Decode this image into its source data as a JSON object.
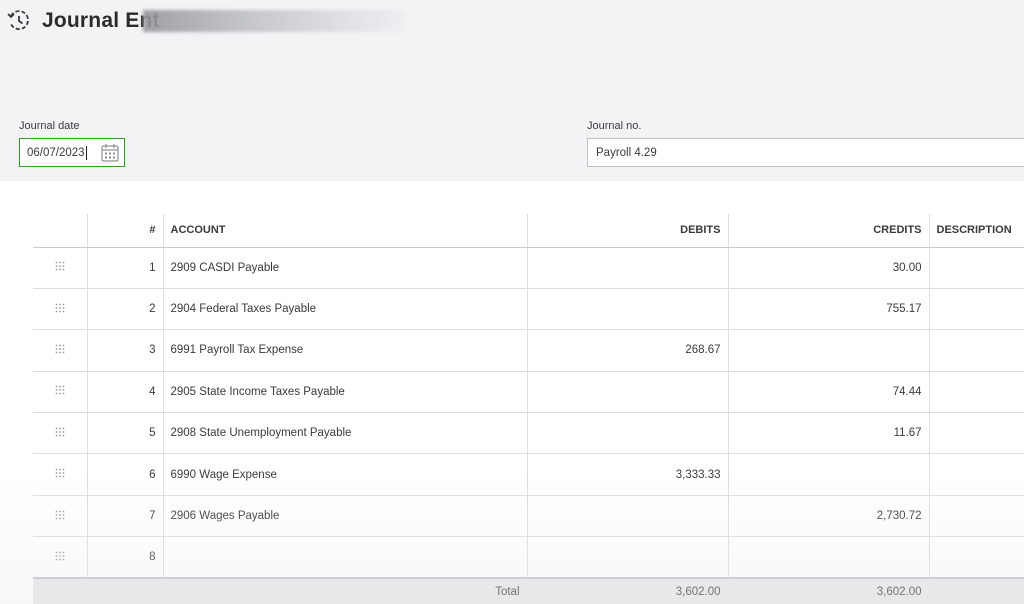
{
  "header": {
    "title": "Journal Ent",
    "icon": "history-icon"
  },
  "form": {
    "date_label": "Journal date",
    "date_value": "06/07/2023",
    "number_label": "Journal no.",
    "number_value": "Payroll 4.29"
  },
  "table": {
    "columns": {
      "num": "#",
      "account": "ACCOUNT",
      "debits": "DEBITS",
      "credits": "CREDITS",
      "description": "DESCRIPTION"
    },
    "rows": [
      {
        "n": "1",
        "account": "2909 CASDI Payable",
        "debit": "",
        "credit": "30.00"
      },
      {
        "n": "2",
        "account": "2904 Federal Taxes Payable",
        "debit": "",
        "credit": "755.17"
      },
      {
        "n": "3",
        "account": "6991 Payroll Tax Expense",
        "debit": "268.67",
        "credit": ""
      },
      {
        "n": "4",
        "account": "2905 State Income Taxes Payable",
        "debit": "",
        "credit": "74.44"
      },
      {
        "n": "5",
        "account": "2908 State Unemployment Payable",
        "debit": "",
        "credit": "11.67"
      },
      {
        "n": "6",
        "account": "6990 Wage Expense",
        "debit": "3,333.33",
        "credit": ""
      },
      {
        "n": "7",
        "account": "2906 Wages Payable",
        "debit": "",
        "credit": "2,730.72"
      },
      {
        "n": "8",
        "account": "",
        "debit": "",
        "credit": ""
      }
    ],
    "total": {
      "label": "Total",
      "debits": "3,602.00",
      "credits": "3,602.00"
    }
  },
  "colors": {
    "accent_green": "#2ca01c",
    "band": "#f2f3f5"
  }
}
